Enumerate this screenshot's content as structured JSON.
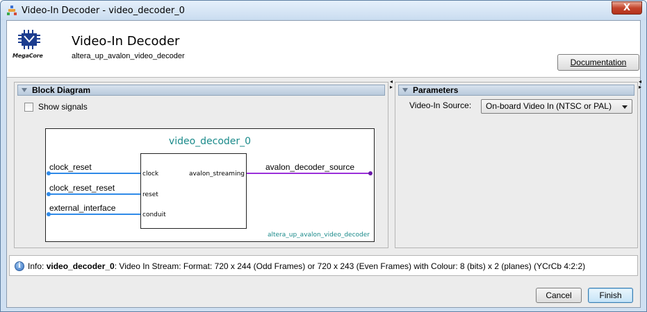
{
  "window": {
    "title": "Video-In Decoder - video_decoder_0",
    "close_label": "X"
  },
  "header": {
    "logo_text": "MegaCore",
    "title": "Video-In Decoder",
    "subtitle": "altera_up_avalon_video_decoder",
    "documentation_label": "Documentation"
  },
  "block_diagram": {
    "heading": "Block Diagram",
    "show_signals_label": "Show signals",
    "show_signals_checked": false,
    "instance_name": "video_decoder_0",
    "component_name": "altera_up_avalon_video_decoder",
    "signals": [
      "clock_reset",
      "clock_reset_reset",
      "external_interface"
    ],
    "ports_left": [
      "clock",
      "reset",
      "conduit"
    ],
    "port_right": "avalon_streaming",
    "output_signal": "avalon_decoder_source"
  },
  "parameters": {
    "heading": "Parameters",
    "video_in_source_label": "Video-In Source:",
    "video_in_source_value": "On-board Video In (NTSC or PAL)"
  },
  "info": {
    "prefix": "Info: ",
    "instance": "video_decoder_0",
    "message": ": Video In Stream: Format: 720 x 244 (Odd Frames) or 720 x 243 (Even Frames) with Colour: 8 (bits) x 2 (planes) (YCrCb 4:2:2)"
  },
  "buttons": {
    "cancel": "Cancel",
    "finish": "Finish"
  },
  "colors": {
    "accent_teal": "#1a8a8a",
    "wire_blue": "#2f8ae8",
    "wire_purple": "#9b30d9"
  }
}
